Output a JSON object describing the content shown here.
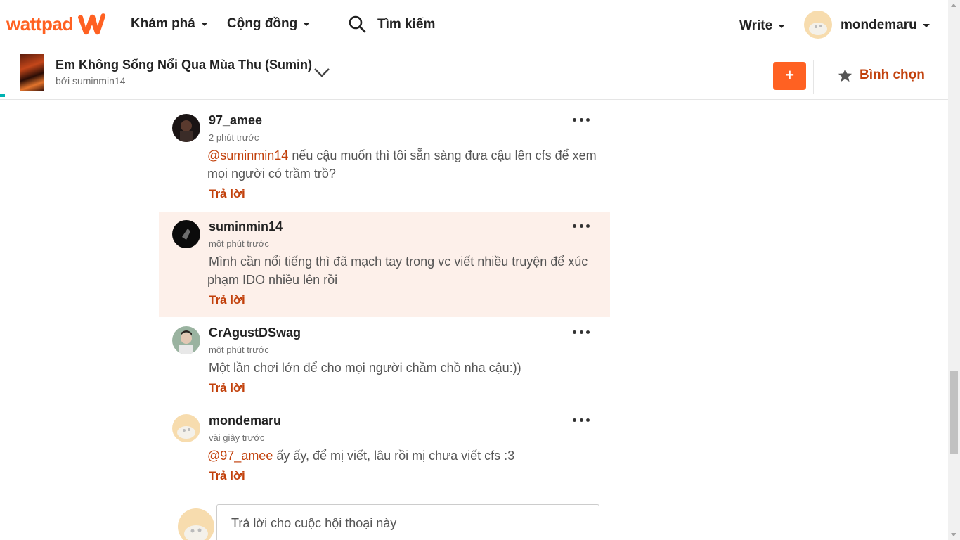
{
  "nav": {
    "logo_text": "wattpad",
    "discover_label": "Khám phá",
    "community_label": "Cộng đồng",
    "search_placeholder": "Tìm kiếm",
    "write_label": "Write",
    "username": "mondemaru"
  },
  "story": {
    "title": "Em Không Sống Nổi Qua Mùa Thu (Sumin)",
    "byline": "bởi suminmin14",
    "add_label": "+",
    "vote_label": "Bình chọn"
  },
  "comments": [
    {
      "user": "97_amee",
      "time": "2 phút trước",
      "mention": "@suminmin14",
      "text": " nếu cậu muốn thì tôi sẵn sàng đưa cậu lên cfs để xem mọi người có trầm trồ?",
      "reply_label": "Trả lời"
    },
    {
      "user": "suminmin14",
      "time": "một phút trước",
      "mention": "",
      "text": "Mình cần nổi tiếng thì đã mạch tay trong vc viết nhiều truyện để xúc phạm IDO nhiều lên rồi",
      "reply_label": "Trả lời"
    },
    {
      "user": "CrAgustDSwag",
      "time": "một phút trước",
      "mention": "",
      "text": "Một lần chơi lớn để cho mọi người chầm chồ nha cậu:))",
      "reply_label": "Trả lời"
    },
    {
      "user": "mondemaru",
      "time": "vài giây trước",
      "mention": "@97_amee",
      "text": " ấy ấy, để mị viết, lâu rồi mị chưa viết cfs :3",
      "reply_label": "Trả lời"
    }
  ],
  "reply_box": {
    "placeholder": "Trả lời cho cuộc hội thoại này"
  },
  "colors": {
    "brand": "#ff6122",
    "accent_text": "#c2410c",
    "highlight_bg": "#fdf0ea"
  }
}
